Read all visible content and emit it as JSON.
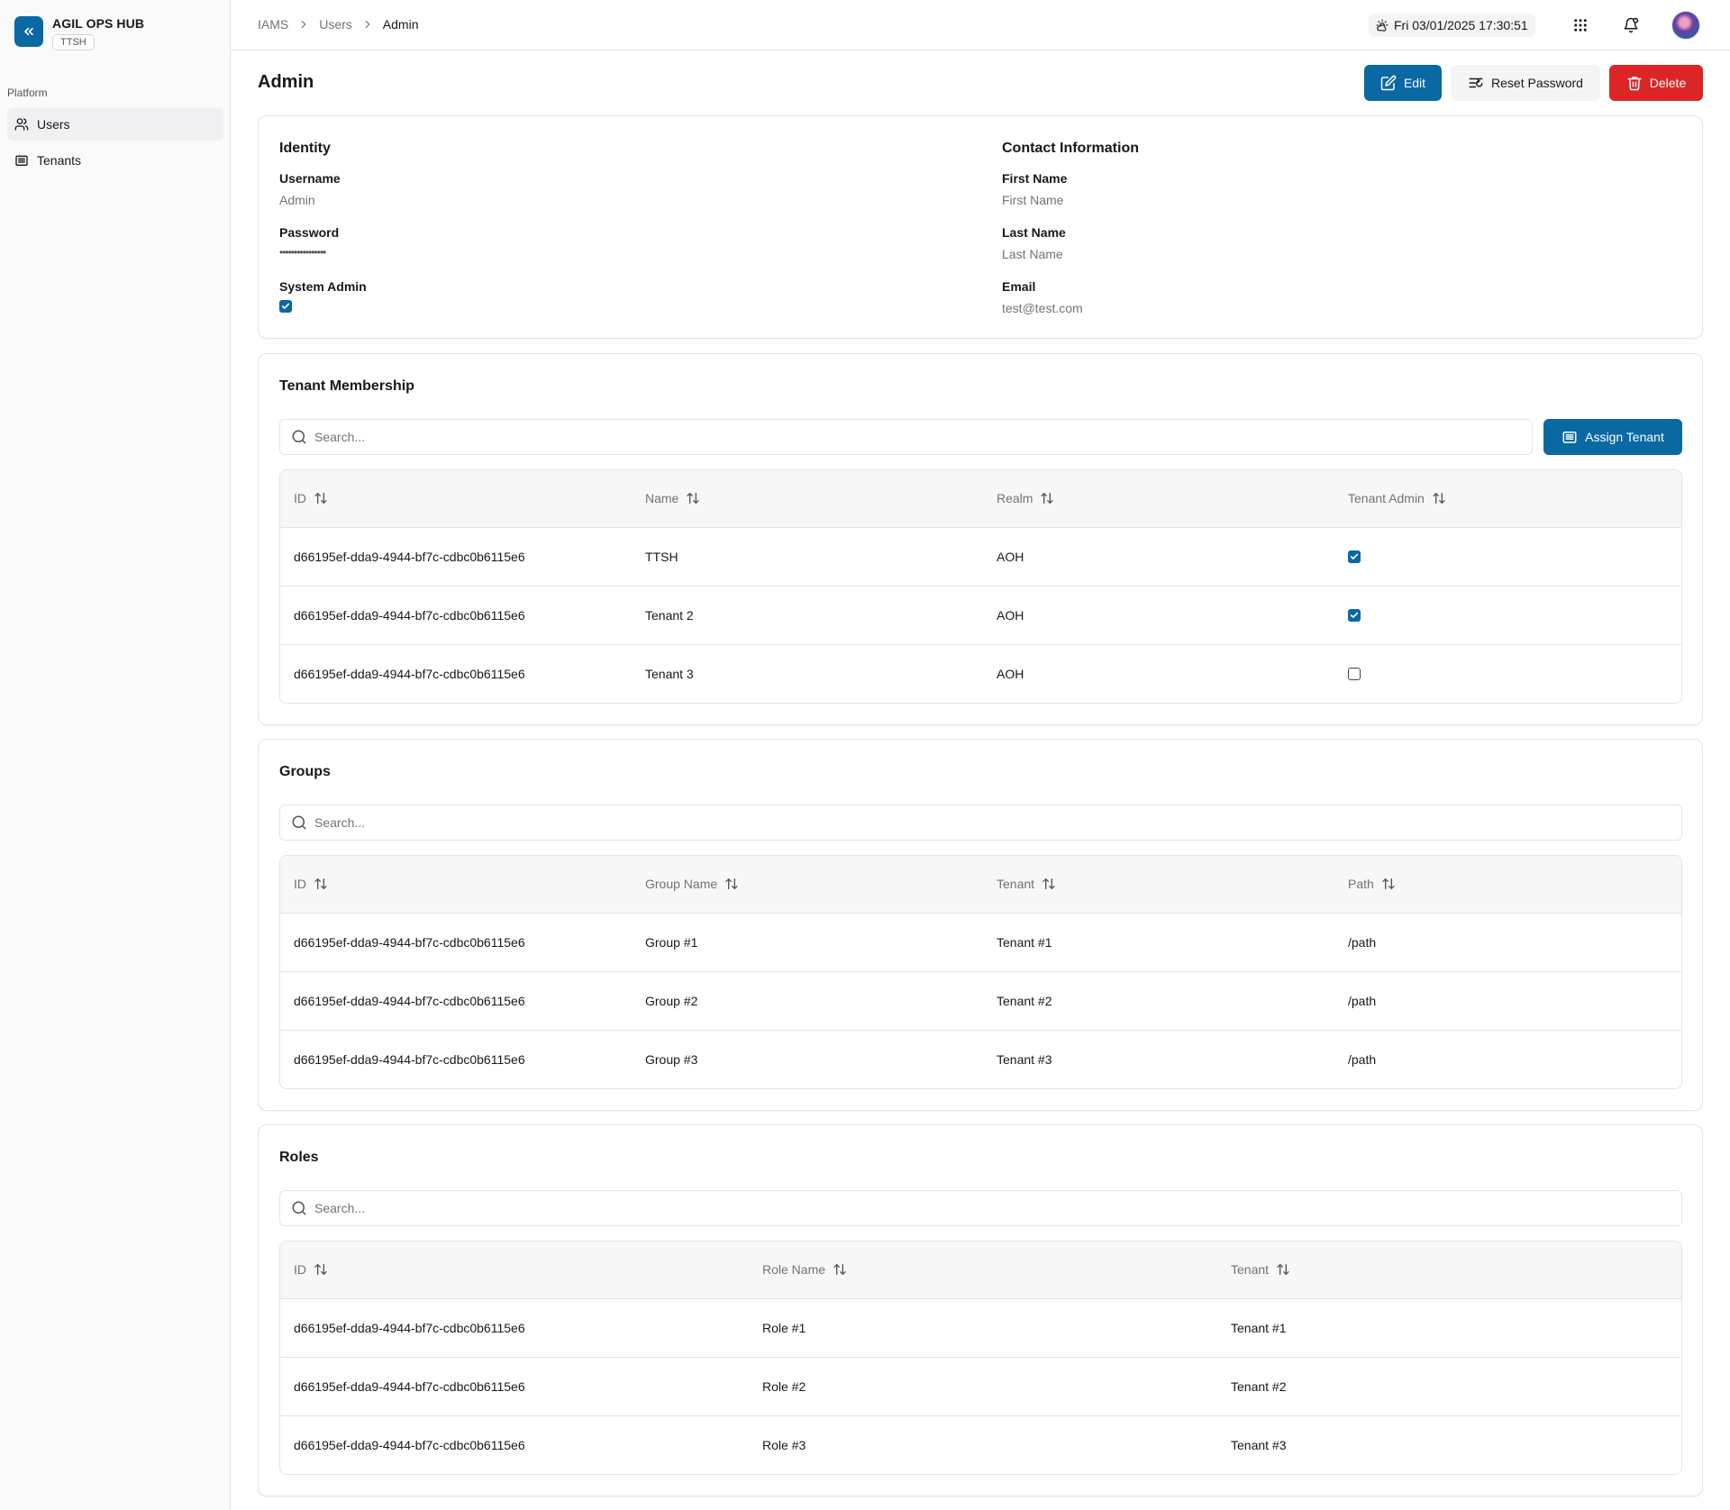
{
  "app": {
    "name": "AGIL OPS HUB",
    "badge": "TTSH",
    "accent": "#0a68a3",
    "danger": "#dc2626"
  },
  "sidebar": {
    "section": "Platform",
    "items": [
      {
        "label": "Users",
        "icon": "users-icon",
        "active": true
      },
      {
        "label": "Tenants",
        "icon": "building-icon",
        "active": false
      }
    ]
  },
  "header": {
    "breadcrumb": [
      "IAMS",
      "Users",
      "Admin"
    ],
    "datetime": "Fri 03/01/2025 17:30:51",
    "icons": [
      "weather-icon",
      "apps-grid-icon",
      "bell-icon",
      "avatar"
    ]
  },
  "page": {
    "title": "Admin",
    "actions": {
      "edit": "Edit",
      "reset": "Reset Password",
      "delete": "Delete"
    }
  },
  "identity": {
    "title": "Identity",
    "username_label": "Username",
    "username_value": "Admin",
    "password_label": "Password",
    "password_value": "••••••••••••••••",
    "system_admin_label": "System Admin",
    "system_admin": true
  },
  "contact": {
    "title": "Contact Information",
    "first_name_label": "First Name",
    "first_name_value": "First Name",
    "last_name_label": "Last Name",
    "last_name_value": "Last Name",
    "email_label": "Email",
    "email_value": "test@test.com"
  },
  "tenants": {
    "title": "Tenant Membership",
    "search_placeholder": "Search...",
    "assign_label": "Assign Tenant",
    "columns": [
      "ID",
      "Name",
      "Realm",
      "Tenant Admin"
    ],
    "rows": [
      {
        "id": "d66195ef-dda9-4944-bf7c-cdbc0b6115e6",
        "name": "TTSH",
        "realm": "AOH",
        "admin": true
      },
      {
        "id": "d66195ef-dda9-4944-bf7c-cdbc0b6115e6",
        "name": "Tenant 2",
        "realm": "AOH",
        "admin": true
      },
      {
        "id": "d66195ef-dda9-4944-bf7c-cdbc0b6115e6",
        "name": "Tenant 3",
        "realm": "AOH",
        "admin": false
      }
    ]
  },
  "groups": {
    "title": "Groups",
    "search_placeholder": "Search...",
    "columns": [
      "ID",
      "Group Name",
      "Tenant",
      "Path"
    ],
    "rows": [
      {
        "id": "d66195ef-dda9-4944-bf7c-cdbc0b6115e6",
        "name": "Group #1",
        "tenant": "Tenant #1",
        "path": "/path"
      },
      {
        "id": "d66195ef-dda9-4944-bf7c-cdbc0b6115e6",
        "name": "Group #2",
        "tenant": "Tenant #2",
        "path": "/path"
      },
      {
        "id": "d66195ef-dda9-4944-bf7c-cdbc0b6115e6",
        "name": "Group #3",
        "tenant": "Tenant #3",
        "path": "/path"
      }
    ]
  },
  "roles": {
    "title": "Roles",
    "search_placeholder": "Search...",
    "columns": [
      "ID",
      "Role Name",
      "Tenant"
    ],
    "rows": [
      {
        "id": "d66195ef-dda9-4944-bf7c-cdbc0b6115e6",
        "name": "Role #1",
        "tenant": "Tenant #1"
      },
      {
        "id": "d66195ef-dda9-4944-bf7c-cdbc0b6115e6",
        "name": "Role #2",
        "tenant": "Tenant #2"
      },
      {
        "id": "d66195ef-dda9-4944-bf7c-cdbc0b6115e6",
        "name": "Role #3",
        "tenant": "Tenant #3"
      }
    ]
  }
}
